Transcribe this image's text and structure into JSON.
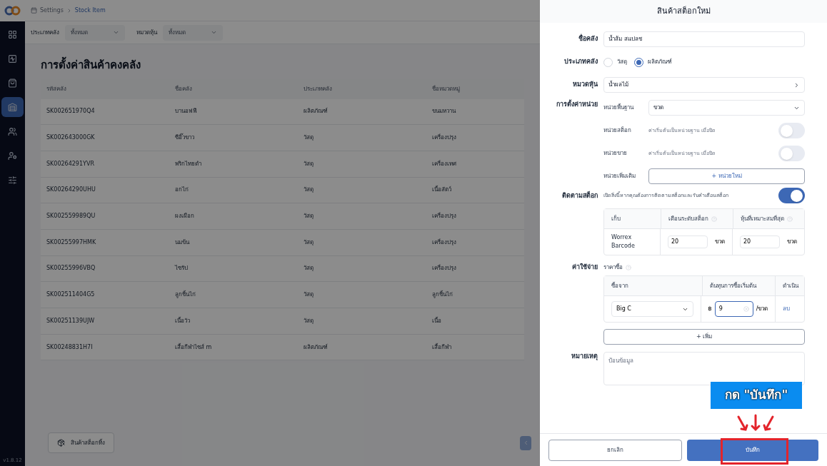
{
  "breadcrumb": {
    "items": [
      "Settings",
      "Stock Item"
    ]
  },
  "sidebar": {
    "items": [
      {
        "selected": false
      },
      {
        "selected": false
      },
      {
        "selected": false
      },
      {
        "selected": true
      },
      {
        "selected": false
      },
      {
        "selected": false
      },
      {
        "selected": false
      }
    ],
    "version": "v1.8.12"
  },
  "filters": [
    {
      "label": "ประเภทคลัง",
      "placeholder": "ทั้งหมด"
    },
    {
      "label": "หมวดหุ้น",
      "placeholder": "ทั้งหมด"
    }
  ],
  "page_title": "การตั้งค่าสินค้าคงคลัง",
  "table": {
    "columns": [
      "รหัสคลัง",
      "ชื่อคลัง",
      "ประเภทคลัง",
      "ชื่อหมวดหมู่"
    ],
    "rows": [
      [
        "SK002651970Q4",
        "บานอฟฟี",
        "ผลิตภัณฑ์",
        "ขนมหวาน"
      ],
      [
        "SK002643000GK",
        "ซีอิ๊วขาว",
        "วัสดุ",
        "เครื่องปรุง"
      ],
      [
        "SK00264291YVR",
        "พริกไทยดำ",
        "วัสดุ",
        "เครื่องเทศ"
      ],
      [
        "SK00264290UHU",
        "อกไก่",
        "วัสดุ",
        "เนื้อสัตว์"
      ],
      [
        "SK002559989QU",
        "ผงเผือก",
        "วัสดุ",
        "เครื่องปรุง"
      ],
      [
        "SK00255997HMK",
        "นมข้น",
        "วัสดุ",
        "เครื่องปรุง"
      ],
      [
        "SK00255996VBQ",
        "ไซรัป",
        "วัสดุ",
        "เครื่องปรุง"
      ],
      [
        "SK002511404G5",
        "ลูกชิ้นไก่",
        "วัสดุ",
        "ลูกชิ้นไก่"
      ],
      [
        "SK00251139UJW",
        "เนื้อวัว",
        "วัสดุ",
        "เนื้อ"
      ],
      [
        "SK00248831H7I",
        "เสื้อกีฬาไซส์ m",
        "ผลิตภัณฑ์",
        "เสื้อกีฬา"
      ]
    ]
  },
  "bottom_button": "สินค้าสต็อกทิ้ง",
  "drawer": {
    "title": "สินค้าสต็อกใหม่",
    "name": {
      "label": "ชื่อคลัง",
      "value": "น้ำส้ม สแปลช"
    },
    "type": {
      "label": "ประเภทคลัง",
      "options": [
        {
          "label": "วัสดุ",
          "selected": false
        },
        {
          "label": "ผลิตภัณฑ์",
          "selected": true
        }
      ]
    },
    "category": {
      "label": "หมวดหุ้น",
      "value": "น้ำผลไม้"
    },
    "units": {
      "label": "การตั้งค่าหน่วย",
      "base_label": "หน่วยพื้นฐาน",
      "base_value": "ขวด",
      "toggles": [
        {
          "label": "หน่วยสต็อก",
          "hint": "ค่าเริ่มต้นเป็นหน่วยฐาน เมื่อปิด",
          "on": false
        },
        {
          "label": "หน่วยขาย",
          "hint": "ค่าเริ่มต้นเป็นหน่วยฐาน เมื่อปิด",
          "on": false
        }
      ],
      "extra_label": "หน่วยเพิ่มเติม",
      "add_button": "+ หน่วยใหม่"
    },
    "tracking": {
      "label": "ติดตามสต็อก",
      "hint": "เปิดสิ่งนี้หากคุณต้องการติดตามสต็อกและรับคำเตือนสต็อก",
      "on": true,
      "columns": [
        "เก็บ",
        "เตือนระดับสต็อก",
        "หุ้นที่เหมาะสมที่สุด"
      ],
      "rows": [
        {
          "store": "Worrex Barcode",
          "alert": "20",
          "alert_unit": "ขวด",
          "optimal": "20",
          "optimal_unit": "ขวด"
        }
      ]
    },
    "cost": {
      "label": "ค่าใช้จ่าย",
      "sub_label": "ราคาซื้อ",
      "columns": [
        "ซื้อจาก",
        "ต้นทุนการซื้อเริ่มต้น",
        "ดำเนิน"
      ],
      "rows": [
        {
          "supplier": "Big C",
          "currency": "฿",
          "price": "9",
          "unit": "/ขวด",
          "action": "ลบ"
        }
      ],
      "add_button": "+ เพิ่ม"
    },
    "note": {
      "label": "หมายเหตุ",
      "placeholder": "ป้อนข้อมูล"
    },
    "buttons": {
      "cancel": "ยกเลิก",
      "save": "บันทึก"
    }
  },
  "callout": {
    "text": "กด \"บันทึก\""
  }
}
